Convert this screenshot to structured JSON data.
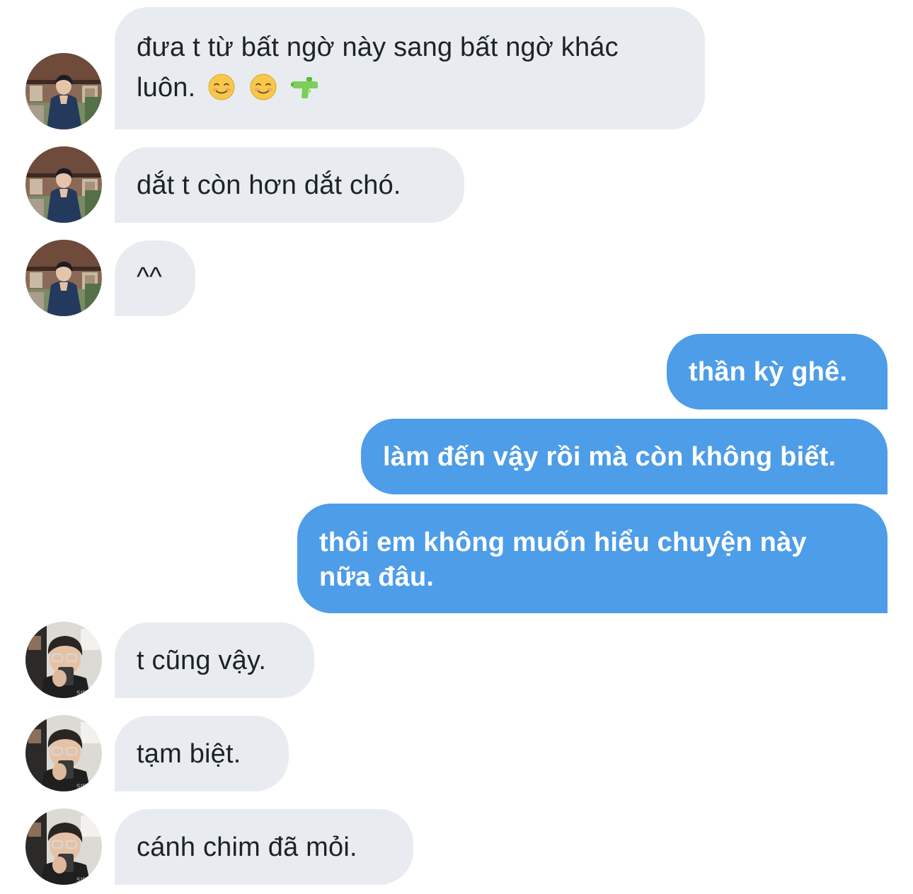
{
  "conversation": {
    "messages": [
      {
        "id": "m1",
        "sender": "contact-a",
        "text_line1": "đưa t từ bất ngờ này sang bất ngờ khác",
        "text_line2": "luôn.",
        "emojis": [
          "smiling-face-icon",
          "smiling-face-icon",
          "water-pistol-icon"
        ]
      },
      {
        "id": "m2",
        "sender": "contact-a",
        "text": "dắt t còn hơn dắt chó."
      },
      {
        "id": "m3",
        "sender": "contact-a",
        "text": "^^"
      },
      {
        "id": "m4",
        "sender": "me",
        "text": "thần kỳ ghê."
      },
      {
        "id": "m5",
        "sender": "me",
        "text": "làm đến vậy rồi mà còn không biết."
      },
      {
        "id": "m6",
        "sender": "me",
        "text_line1": "thôi em không muốn hiểu chuyện này",
        "text_line2": "nữa đâu."
      },
      {
        "id": "m7",
        "sender": "contact-b",
        "text": "t cũng vậy."
      },
      {
        "id": "m8",
        "sender": "contact-b",
        "text": "tạm biệt."
      },
      {
        "id": "m9",
        "sender": "contact-b",
        "text": "cánh chim đã mỏi."
      }
    ]
  },
  "colors": {
    "incoming_bubble": "#e8ecf0",
    "outgoing_bubble": "#4d9de8",
    "incoming_text": "#1d2227",
    "outgoing_text": "#ffffff"
  }
}
